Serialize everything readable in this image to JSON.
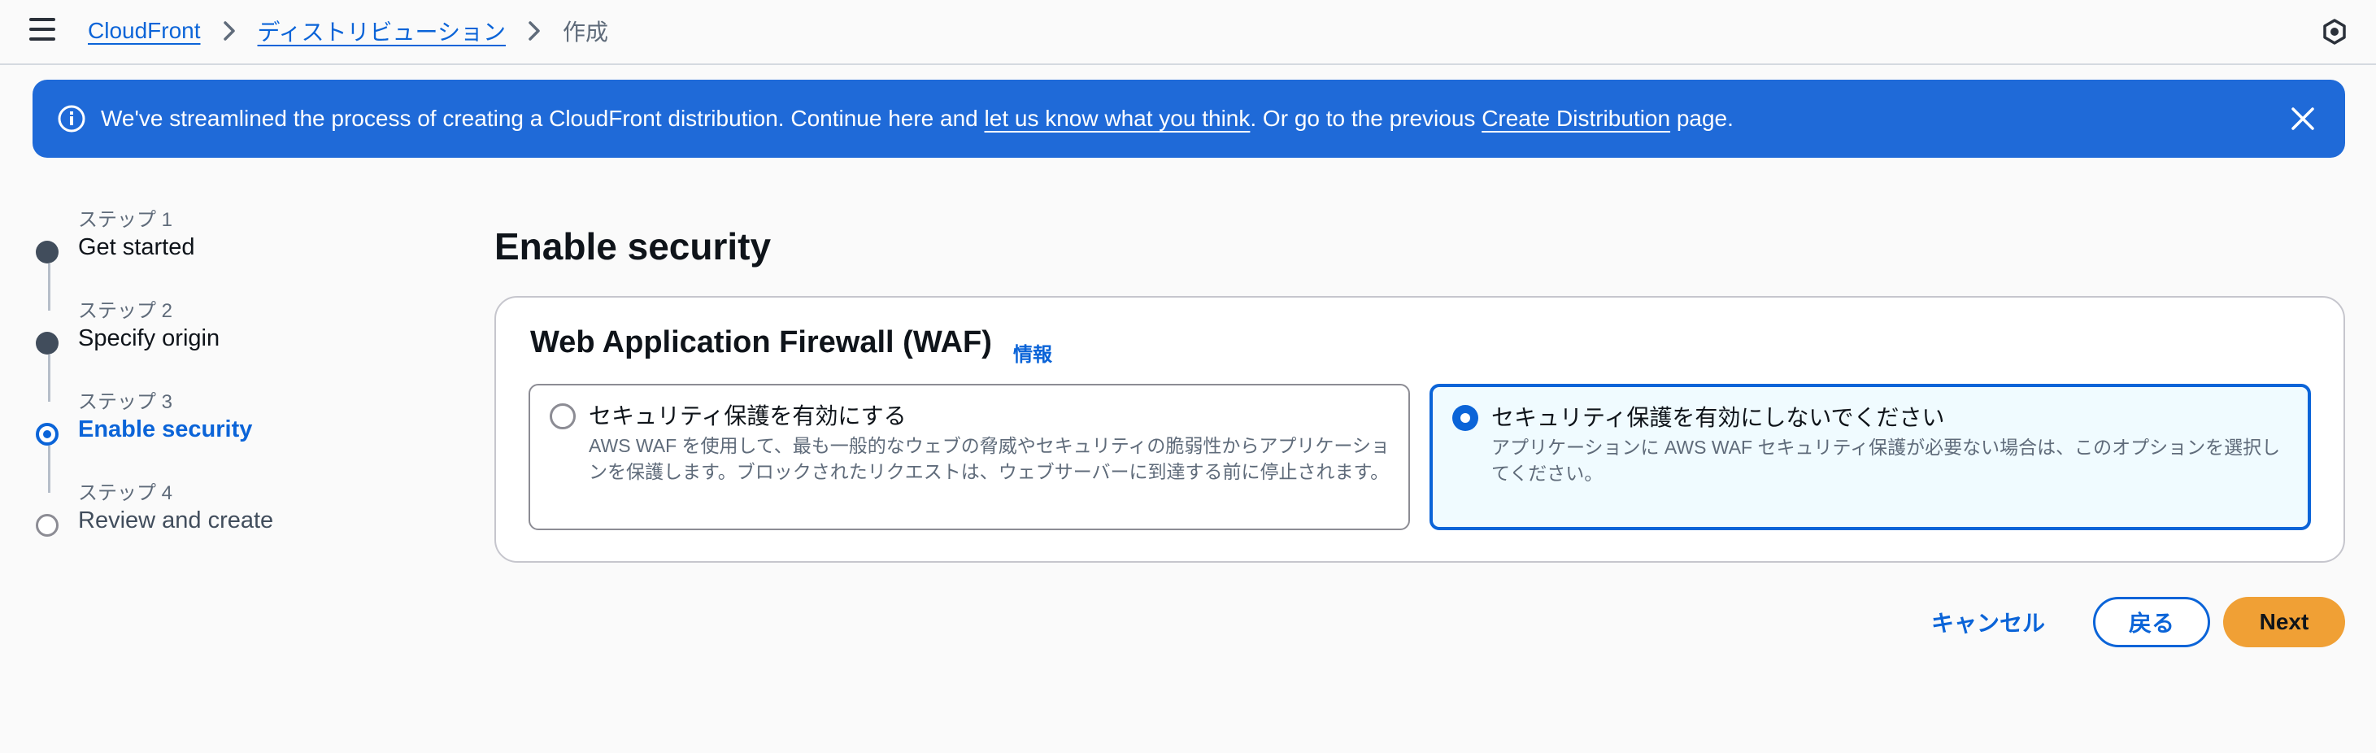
{
  "breadcrumb": {
    "items": [
      {
        "label": "CloudFront"
      },
      {
        "label": "ディストリビューション"
      }
    ],
    "current": "作成"
  },
  "flash": {
    "text_1": "We've streamlined the process of creating a CloudFront distribution. Continue here and ",
    "link_1": "let us know what you think",
    "text_2": ". Or go to the previous ",
    "link_2": "Create Distribution",
    "text_3": " page.",
    "color": "#1f6ad8"
  },
  "steps": [
    {
      "kicker": "ステップ 1",
      "title": "Get started",
      "state": "complete"
    },
    {
      "kicker": "ステップ 2",
      "title": "Specify origin",
      "state": "complete"
    },
    {
      "kicker": "ステップ 3",
      "title": "Enable security",
      "state": "active"
    },
    {
      "kicker": "ステップ 4",
      "title": "Review and create",
      "state": "future"
    }
  ],
  "main": {
    "title": "Enable security",
    "waf": {
      "heading": "Web Application Firewall (WAF)",
      "info_link": "情報",
      "options": [
        {
          "label": "セキュリティ保護を有効にする",
          "description": "AWS WAF を使用して、最も一般的なウェブの脅威やセキュリティの脆弱性からアプリケーションを保護します。ブロックされたリクエストは、ウェブサーバーに到達する前に停止されます。",
          "selected": false
        },
        {
          "label": "セキュリティ保護を有効にしないでください",
          "description": "アプリケーションに AWS WAF セキュリティ保護が必要ない場合は、このオプションを選択してください。",
          "selected": true
        }
      ]
    }
  },
  "actions": {
    "cancel": "キャンセル",
    "back": "戻る",
    "next": "Next"
  },
  "colors": {
    "accent": "#0b64d8",
    "primary_button": "#f0a035"
  }
}
